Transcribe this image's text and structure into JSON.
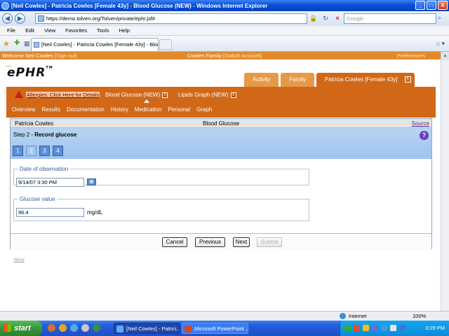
{
  "window": {
    "title": "[Neil Cowles] - Patricia Cowles [Female 43y] - Blood Glucose (NEW) - Windows Internet Explorer",
    "minimize": "_",
    "maximize": "□",
    "close": "X"
  },
  "addressbar": {
    "back": "◀",
    "forward": "▶",
    "url": "https://demo.tolven.org/Tolven/private/ephr.jsf#",
    "search_placeholder": "Google",
    "search_icon": "⌕"
  },
  "menu": [
    "File",
    "Edit",
    "View",
    "Favorites",
    "Tools",
    "Help"
  ],
  "browser_tab": {
    "label": "[Neil Cowles] - Patricia Cowles [Female 43y] - Blood Gl...",
    "commands": "⌂ ▾"
  },
  "app": {
    "welcome": "Welcome Neil Cowles",
    "sign_out": "[Sign out]",
    "account": "Cowles Family",
    "switch_account": "[Switch Account]",
    "preferences": "Preferences",
    "logo": "ePHR",
    "logo_tm": "TM",
    "context_tabs": [
      "Activity",
      "Family",
      "Patricia Cowles [Female 43y]"
    ],
    "context_close": "X",
    "allergies_link": "Allergies: Click Here for Details",
    "sub_tabs": [
      "Blood Glucose (NEW)",
      "Lipids Graph (NEW)"
    ],
    "sub_tab_close": "X",
    "nav": [
      "Overview",
      "Results",
      "Documentation",
      "History",
      "Medication",
      "Personal",
      "Graph"
    ]
  },
  "form": {
    "patient": "Patricia Cowles",
    "title": "Blood Glucose",
    "source": "Source",
    "step_prefix": "Step 2 - ",
    "step_name": "Record glucose",
    "help": "?",
    "steps": [
      "1",
      "2",
      "3",
      "4"
    ],
    "date_legend": "Date of observation",
    "date_value": "9/14/07 3:30 PM",
    "calendar_icon": "▦",
    "glucose_legend": "Glucose value",
    "glucose_value": "96.4",
    "glucose_unit": "mg/dL",
    "buttons": {
      "cancel": "Cancel",
      "previous": "Previous",
      "next": "Next",
      "submit": "Submit"
    }
  },
  "more": "More",
  "status": {
    "zone": "Internet",
    "zoom": "100%"
  },
  "taskbar": {
    "start": "start",
    "tasks": [
      "[Neil Cowles] - Patrici...",
      "Microsoft PowerPoint ..."
    ],
    "clock": "3:29 PM"
  },
  "colors": {
    "brand_orange": "#d16818",
    "welcome_bar": "#e28a2b",
    "step_band": "#9ec3ee",
    "legend_blue": "#2f5fa8"
  }
}
